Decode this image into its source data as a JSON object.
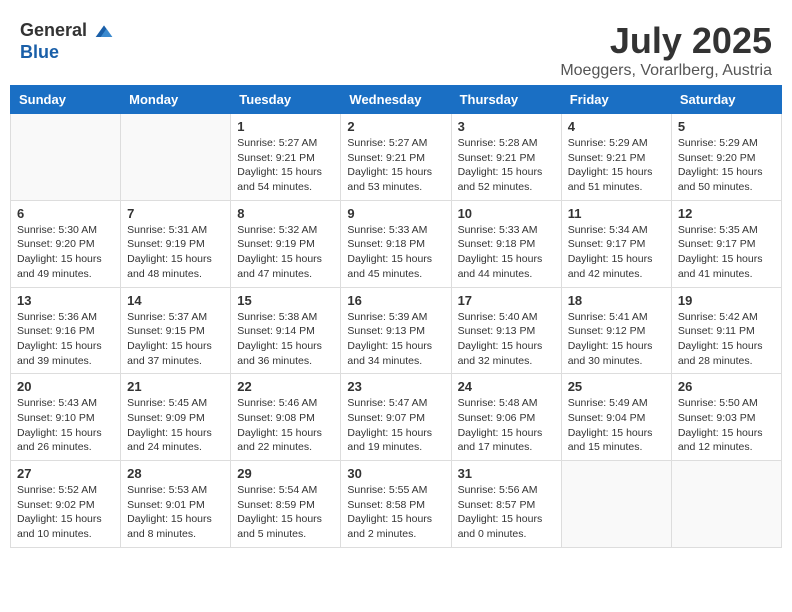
{
  "header": {
    "logo": {
      "text_general": "General",
      "text_blue": "Blue"
    },
    "title": "July 2025",
    "location": "Moeggers, Vorarlberg, Austria"
  },
  "days_of_week": [
    "Sunday",
    "Monday",
    "Tuesday",
    "Wednesday",
    "Thursday",
    "Friday",
    "Saturday"
  ],
  "weeks": [
    [
      {
        "day": "",
        "info": ""
      },
      {
        "day": "",
        "info": ""
      },
      {
        "day": "1",
        "info": "Sunrise: 5:27 AM\nSunset: 9:21 PM\nDaylight: 15 hours\nand 54 minutes."
      },
      {
        "day": "2",
        "info": "Sunrise: 5:27 AM\nSunset: 9:21 PM\nDaylight: 15 hours\nand 53 minutes."
      },
      {
        "day": "3",
        "info": "Sunrise: 5:28 AM\nSunset: 9:21 PM\nDaylight: 15 hours\nand 52 minutes."
      },
      {
        "day": "4",
        "info": "Sunrise: 5:29 AM\nSunset: 9:21 PM\nDaylight: 15 hours\nand 51 minutes."
      },
      {
        "day": "5",
        "info": "Sunrise: 5:29 AM\nSunset: 9:20 PM\nDaylight: 15 hours\nand 50 minutes."
      }
    ],
    [
      {
        "day": "6",
        "info": "Sunrise: 5:30 AM\nSunset: 9:20 PM\nDaylight: 15 hours\nand 49 minutes."
      },
      {
        "day": "7",
        "info": "Sunrise: 5:31 AM\nSunset: 9:19 PM\nDaylight: 15 hours\nand 48 minutes."
      },
      {
        "day": "8",
        "info": "Sunrise: 5:32 AM\nSunset: 9:19 PM\nDaylight: 15 hours\nand 47 minutes."
      },
      {
        "day": "9",
        "info": "Sunrise: 5:33 AM\nSunset: 9:18 PM\nDaylight: 15 hours\nand 45 minutes."
      },
      {
        "day": "10",
        "info": "Sunrise: 5:33 AM\nSunset: 9:18 PM\nDaylight: 15 hours\nand 44 minutes."
      },
      {
        "day": "11",
        "info": "Sunrise: 5:34 AM\nSunset: 9:17 PM\nDaylight: 15 hours\nand 42 minutes."
      },
      {
        "day": "12",
        "info": "Sunrise: 5:35 AM\nSunset: 9:17 PM\nDaylight: 15 hours\nand 41 minutes."
      }
    ],
    [
      {
        "day": "13",
        "info": "Sunrise: 5:36 AM\nSunset: 9:16 PM\nDaylight: 15 hours\nand 39 minutes."
      },
      {
        "day": "14",
        "info": "Sunrise: 5:37 AM\nSunset: 9:15 PM\nDaylight: 15 hours\nand 37 minutes."
      },
      {
        "day": "15",
        "info": "Sunrise: 5:38 AM\nSunset: 9:14 PM\nDaylight: 15 hours\nand 36 minutes."
      },
      {
        "day": "16",
        "info": "Sunrise: 5:39 AM\nSunset: 9:13 PM\nDaylight: 15 hours\nand 34 minutes."
      },
      {
        "day": "17",
        "info": "Sunrise: 5:40 AM\nSunset: 9:13 PM\nDaylight: 15 hours\nand 32 minutes."
      },
      {
        "day": "18",
        "info": "Sunrise: 5:41 AM\nSunset: 9:12 PM\nDaylight: 15 hours\nand 30 minutes."
      },
      {
        "day": "19",
        "info": "Sunrise: 5:42 AM\nSunset: 9:11 PM\nDaylight: 15 hours\nand 28 minutes."
      }
    ],
    [
      {
        "day": "20",
        "info": "Sunrise: 5:43 AM\nSunset: 9:10 PM\nDaylight: 15 hours\nand 26 minutes."
      },
      {
        "day": "21",
        "info": "Sunrise: 5:45 AM\nSunset: 9:09 PM\nDaylight: 15 hours\nand 24 minutes."
      },
      {
        "day": "22",
        "info": "Sunrise: 5:46 AM\nSunset: 9:08 PM\nDaylight: 15 hours\nand 22 minutes."
      },
      {
        "day": "23",
        "info": "Sunrise: 5:47 AM\nSunset: 9:07 PM\nDaylight: 15 hours\nand 19 minutes."
      },
      {
        "day": "24",
        "info": "Sunrise: 5:48 AM\nSunset: 9:06 PM\nDaylight: 15 hours\nand 17 minutes."
      },
      {
        "day": "25",
        "info": "Sunrise: 5:49 AM\nSunset: 9:04 PM\nDaylight: 15 hours\nand 15 minutes."
      },
      {
        "day": "26",
        "info": "Sunrise: 5:50 AM\nSunset: 9:03 PM\nDaylight: 15 hours\nand 12 minutes."
      }
    ],
    [
      {
        "day": "27",
        "info": "Sunrise: 5:52 AM\nSunset: 9:02 PM\nDaylight: 15 hours\nand 10 minutes."
      },
      {
        "day": "28",
        "info": "Sunrise: 5:53 AM\nSunset: 9:01 PM\nDaylight: 15 hours\nand 8 minutes."
      },
      {
        "day": "29",
        "info": "Sunrise: 5:54 AM\nSunset: 8:59 PM\nDaylight: 15 hours\nand 5 minutes."
      },
      {
        "day": "30",
        "info": "Sunrise: 5:55 AM\nSunset: 8:58 PM\nDaylight: 15 hours\nand 2 minutes."
      },
      {
        "day": "31",
        "info": "Sunrise: 5:56 AM\nSunset: 8:57 PM\nDaylight: 15 hours\nand 0 minutes."
      },
      {
        "day": "",
        "info": ""
      },
      {
        "day": "",
        "info": ""
      }
    ]
  ]
}
